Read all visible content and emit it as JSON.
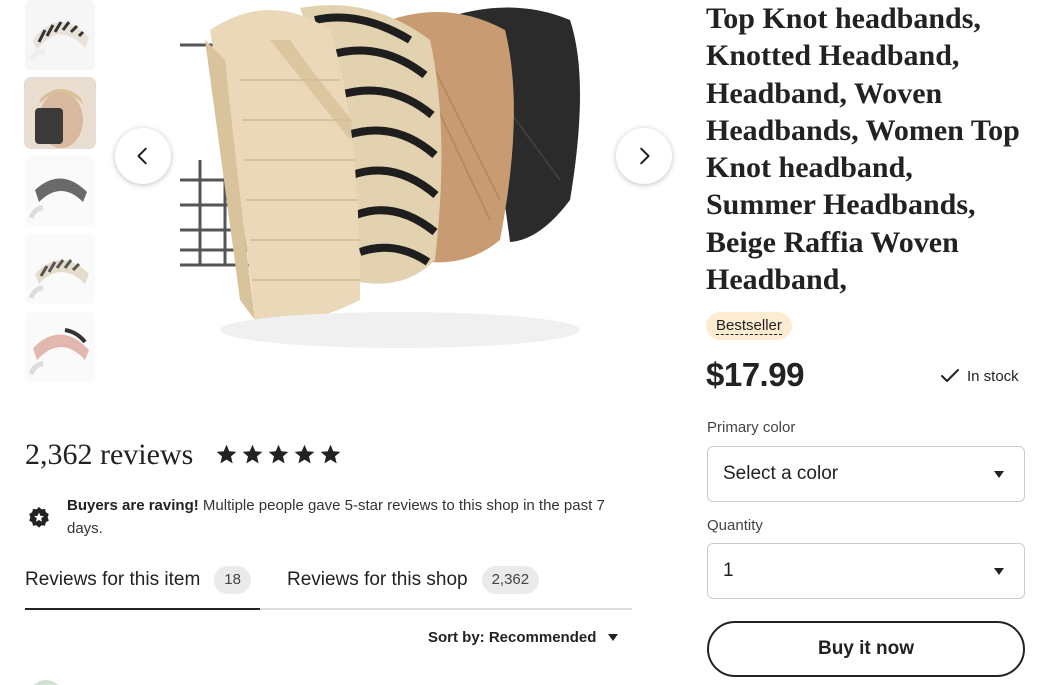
{
  "listing": {
    "title": "Top Knot headbands, Knotted Headband, Headband, Woven Headbands, Women Top Knot headband, Summer Headbands, Beige Raffia Woven Headband,",
    "badge": "Bestseller",
    "price": "$17.99",
    "stock": "In stock"
  },
  "options": {
    "color_label": "Primary color",
    "color_value": "Select a color",
    "quantity_label": "Quantity",
    "quantity_value": "1"
  },
  "actions": {
    "buy_now": "Buy it now"
  },
  "reviews": {
    "count_text": "2,362 reviews",
    "stars": 5,
    "raving_bold": "Buyers are raving!",
    "raving_text": " Multiple people gave 5-star reviews to this shop in the past 7 days.",
    "tabs": [
      {
        "label": "Reviews for this item",
        "count": "18"
      },
      {
        "label": "Reviews for this shop",
        "count": "2,362"
      }
    ],
    "sort_label": "Sort by: Recommended"
  },
  "icons": {
    "prev": "chevron-left-icon",
    "next": "chevron-right-icon",
    "check": "check-icon",
    "star": "star-icon",
    "raving": "star-badge-icon"
  }
}
